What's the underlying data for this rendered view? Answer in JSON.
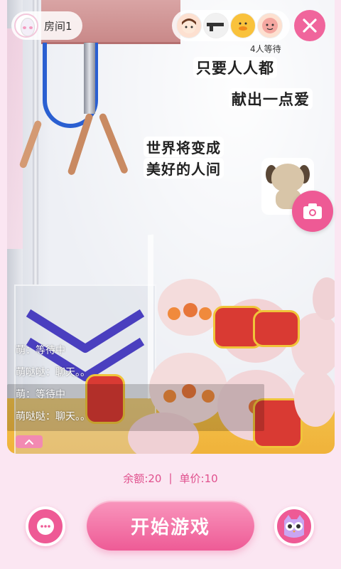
{
  "room": {
    "label": "房间1",
    "avatar_icon": "egg-character-icon"
  },
  "viewers": {
    "avatars": [
      "girl-avatar-icon",
      "gun-avatar-icon",
      "duck-avatar-icon",
      "pink-creature-avatar-icon"
    ],
    "queue_text": "4人等待"
  },
  "stickers": {
    "line1": "只要人人都",
    "line2": "献出一点爱",
    "line3": "世界将变成",
    "line4": "美好的人间"
  },
  "chat": {
    "messages": [
      "萌：等待中",
      "萌哒哒：聊天。。",
      "萌：等待中",
      "萌哒哒：聊天。。"
    ]
  },
  "footer": {
    "balance_label": "余额",
    "balance_value": "20",
    "price_label": "单价",
    "price_value": "10",
    "separator": "|",
    "start_label": "开始游戏"
  },
  "colors": {
    "accent": "#ee5a95",
    "background": "#fbe6f2",
    "text_accent": "#e0508d"
  }
}
